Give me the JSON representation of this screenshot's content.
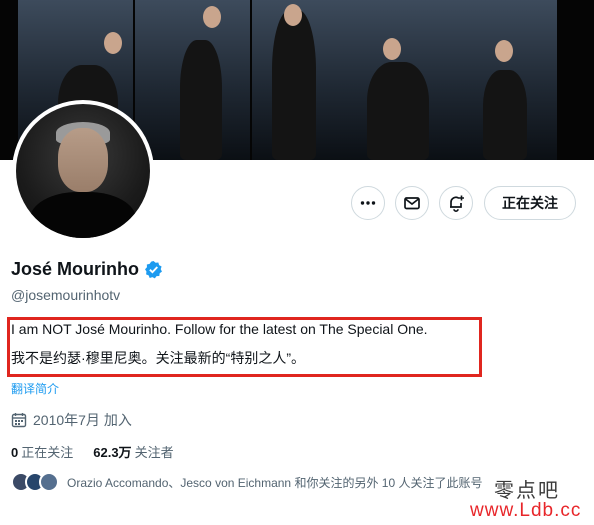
{
  "profile": {
    "display_name": "José Mourinho",
    "handle": "@josemourinhotv",
    "verified": true,
    "bio_line1": "I am NOT José Mourinho. Follow for the latest on The Special One.",
    "bio_line2": "我不是约瑟·穆里尼奥。关注最新的“特别之人”。",
    "translate_label": "翻译简介",
    "joined": "2010年7月 加入"
  },
  "actions": {
    "more_icon": "more-icon",
    "message_icon": "mail-icon",
    "notify_icon": "bell-plus-icon",
    "follow_label": "正在关注"
  },
  "stats": {
    "following_count": "0",
    "following_label": "正在关注",
    "followers_count": "62.3万",
    "followers_label": "关注者"
  },
  "followed_by": {
    "text": "Orazio Accomando、Jesco von Eichmann 和你关注的另外 10 人关注了此账号"
  },
  "watermark": {
    "cn": "零点吧",
    "url": "www.Ldb.cc"
  },
  "colors": {
    "accent": "#1d9bf0",
    "highlight_border": "#e0261f",
    "muted": "#536471",
    "watermark_url": "#e8262a"
  }
}
